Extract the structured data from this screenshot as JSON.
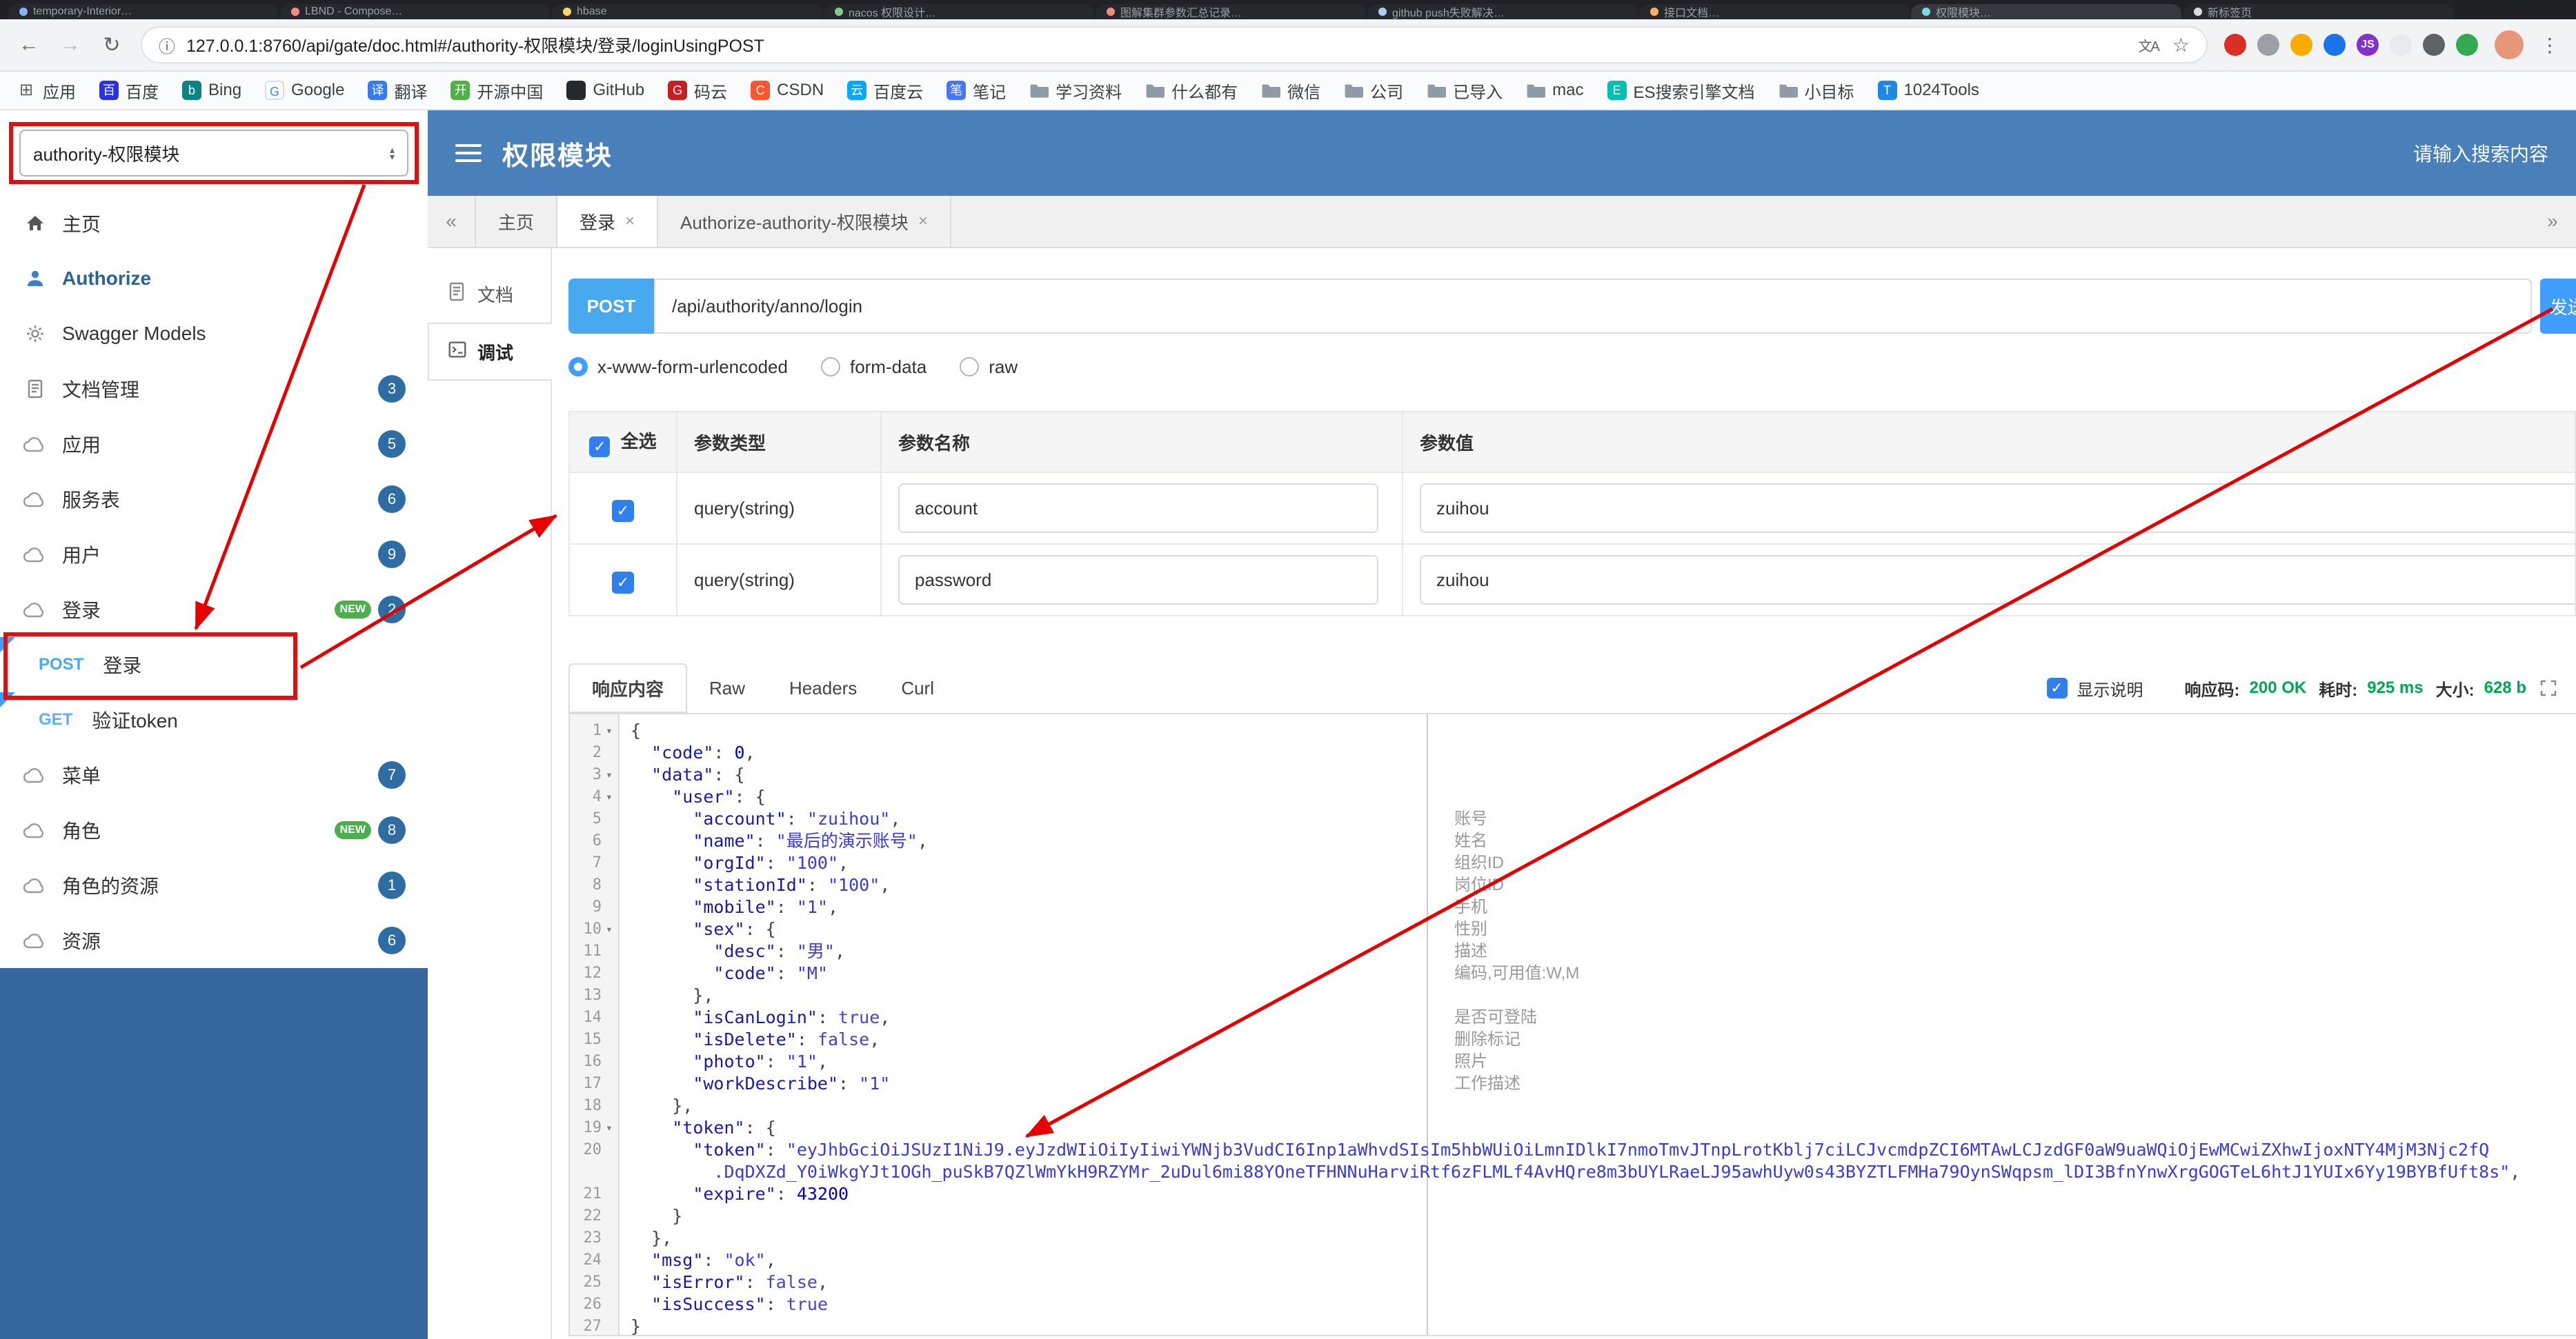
{
  "colors": {
    "header_blue": "#4a80ba",
    "sidebar_blue": "#35679e",
    "accent_blue": "#409eff",
    "method_post": "#49a9ee",
    "method_get": "#61affe",
    "badge_blue": "#2e6da4",
    "success_green": "#00a854",
    "annotation_red": "#e60000"
  },
  "browser": {
    "tabs": [
      {
        "title": "temporary-Interior…",
        "color": "#8ab4f8"
      },
      {
        "title": "LBND - Compose…",
        "color": "#f28b82"
      },
      {
        "title": "hbase",
        "color": "#fdd663"
      },
      {
        "title": "nacos 权限设计…",
        "color": "#81c995"
      },
      {
        "title": "图解集群参数汇总记录…",
        "color": "#f28b82"
      },
      {
        "title": "github push失败解决…",
        "color": "#aecbfa"
      },
      {
        "title": "接口文档…",
        "color": "#fcad70"
      },
      {
        "title": "权限模块…",
        "color": "#78d9ec",
        "active": true
      },
      {
        "title": "新标签页",
        "color": "#dadce0"
      }
    ],
    "nav": {
      "back": "←",
      "forward": "→",
      "reload": "↻"
    },
    "page_info_icon": "ⓘ",
    "url": "127.0.0.1:8760/api/gate/doc.html#/authority-权限模块/登录/loginUsingPOST",
    "translate_icon": "文A",
    "star_icon": "☆",
    "menu_icon": "⋮",
    "extensions": [
      {
        "color": "#d93025"
      },
      {
        "color": "#9aa0a6"
      },
      {
        "color": "#f9ab00"
      },
      {
        "color": "#1a73e8"
      },
      {
        "color": "#8430ce",
        "label": "JS"
      },
      {
        "color": "#e8eaed"
      },
      {
        "color": "#5f6368"
      },
      {
        "color": "#34a853"
      }
    ],
    "bookmarks": [
      {
        "name": "apps",
        "label": "应用",
        "fav": "grid"
      },
      {
        "name": "baidu",
        "label": "百度",
        "fav": "letter",
        "bg": "#2932e1",
        "ch": "百"
      },
      {
        "name": "bing",
        "label": "Bing",
        "fav": "letter",
        "bg": "#0c8484",
        "ch": "b"
      },
      {
        "name": "google",
        "label": "Google",
        "fav": "letter",
        "bg": "#ffffff",
        "ch": "G",
        "border": true
      },
      {
        "name": "translate",
        "label": "翻译",
        "fav": "letter",
        "bg": "#3479f6",
        "ch": "译"
      },
      {
        "name": "oschina",
        "label": "开源中国",
        "fav": "letter",
        "bg": "#4fb044",
        "ch": "开"
      },
      {
        "name": "github",
        "label": "GitHub",
        "fav": "letter",
        "bg": "#24292e",
        "ch": ""
      },
      {
        "name": "gitee",
        "label": "码云",
        "fav": "letter",
        "bg": "#c71d23",
        "ch": "G"
      },
      {
        "name": "csdn",
        "label": "CSDN",
        "fav": "letter",
        "bg": "#fc5531",
        "ch": "C"
      },
      {
        "name": "baiduyun",
        "label": "百度云",
        "fav": "letter",
        "bg": "#06a7ff",
        "ch": "云"
      },
      {
        "name": "note",
        "label": "笔记",
        "fav": "letter",
        "bg": "#4876f9",
        "ch": "笔"
      },
      {
        "name": "study-folder",
        "label": "学习资料",
        "fav": "folder"
      },
      {
        "name": "everything-folder",
        "label": "什么都有",
        "fav": "folder"
      },
      {
        "name": "wechat-folder",
        "label": "微信",
        "fav": "folder"
      },
      {
        "name": "company-folder",
        "label": "公司",
        "fav": "folder"
      },
      {
        "name": "imported-folder",
        "label": "已导入",
        "fav": "folder"
      },
      {
        "name": "mac-folder",
        "label": "mac",
        "fav": "folder"
      },
      {
        "name": "es-docs",
        "label": "ES搜索引擎文档",
        "fav": "letter",
        "bg": "#00bfb3",
        "ch": "E"
      },
      {
        "name": "goal-folder",
        "label": "小目标",
        "fav": "folder"
      },
      {
        "name": "tools1024",
        "label": "1024Tools",
        "fav": "letter",
        "bg": "#1e88e5",
        "ch": "T"
      }
    ]
  },
  "header": {
    "service_select": "authority-权限模块",
    "title": "权限模块",
    "search_placeholder": "请输入搜索内容"
  },
  "sidebar": {
    "items": [
      {
        "name": "home",
        "icon": "home",
        "label": "主页"
      },
      {
        "name": "authorize",
        "icon": "auth",
        "label": "Authorize",
        "bold": true,
        "color": "#2a6496"
      },
      {
        "name": "swagger-models",
        "icon": "gear",
        "label": "Swagger Models"
      },
      {
        "name": "doc-manage",
        "icon": "doc",
        "label": "文档管理",
        "badge": "3"
      },
      {
        "name": "app",
        "icon": "cloud",
        "label": "应用",
        "badge": "5"
      },
      {
        "name": "service-table",
        "icon": "cloud",
        "label": "服务表",
        "badge": "6"
      },
      {
        "name": "user",
        "icon": "cloud",
        "label": "用户",
        "badge": "9"
      },
      {
        "name": "login",
        "icon": "cloud",
        "label": "登录",
        "badge": "2",
        "isNew": true
      },
      {
        "name": "post-login",
        "sub": true,
        "method": "POST",
        "label": "登录",
        "flag": true
      },
      {
        "name": "get-verify-token",
        "sub": true,
        "method": "GET",
        "label": "验证token",
        "flag": true
      },
      {
        "name": "menu",
        "icon": "cloud",
        "label": "菜单",
        "badge": "7"
      },
      {
        "name": "role",
        "icon": "cloud",
        "label": "角色",
        "badge": "8",
        "isNew": true
      },
      {
        "name": "role-resource",
        "icon": "cloud",
        "label": "角色的资源",
        "badge": "1"
      },
      {
        "name": "resource",
        "icon": "cloud",
        "label": "资源",
        "badge": "6"
      }
    ]
  },
  "tabs": {
    "collapse_left": "«",
    "collapse_right": "»",
    "items": [
      {
        "name": "home",
        "label": "主页",
        "closable": false,
        "active": false
      },
      {
        "name": "login",
        "label": "登录",
        "closable": true,
        "active": true
      },
      {
        "name": "authorize",
        "label": "Authorize-authority-权限模块",
        "closable": true,
        "active": false
      }
    ]
  },
  "side_tabs": [
    {
      "name": "doc",
      "label": "文档",
      "icon": "doc",
      "active": false
    },
    {
      "name": "debug",
      "label": "调试",
      "icon": "debug",
      "active": true
    }
  ],
  "request": {
    "method": "POST",
    "url": "/api/authority/anno/login",
    "send_label": "发送",
    "content_types": [
      {
        "label": "x-www-form-urlencoded",
        "selected": true
      },
      {
        "label": "form-data",
        "selected": false
      },
      {
        "label": "raw",
        "selected": false
      }
    ]
  },
  "params": {
    "select_all_label": "全选",
    "headers": [
      "参数类型",
      "参数名称",
      "参数值"
    ],
    "rows": [
      {
        "checked": true,
        "type": "query(string)",
        "name_value": "account",
        "value": "zuihou"
      },
      {
        "checked": true,
        "type": "query(string)",
        "name_value": "password",
        "value": "zuihou"
      }
    ]
  },
  "response": {
    "tabs": [
      {
        "label": "响应内容",
        "active": true
      },
      {
        "label": "Raw",
        "active": false
      },
      {
        "label": "Headers",
        "active": false
      },
      {
        "label": "Curl",
        "active": false
      }
    ],
    "show_desc_checked": true,
    "show_desc_label": "显示说明",
    "meta": [
      {
        "label": "响应码:",
        "value": "200 OK"
      },
      {
        "label": "耗时:",
        "value": "925 ms"
      },
      {
        "label": "大小:",
        "value": "628 b"
      }
    ]
  },
  "code": {
    "lines": [
      {
        "n": 1,
        "fold": true,
        "tokens": [
          [
            "p",
            "{"
          ]
        ]
      },
      {
        "n": 2,
        "tokens": [
          [
            "p",
            "  "
          ],
          [
            "k",
            "\"code\""
          ],
          [
            "p",
            ": "
          ],
          [
            "n",
            "0"
          ],
          [
            "p",
            ","
          ]
        ]
      },
      {
        "n": 3,
        "fold": true,
        "tokens": [
          [
            "p",
            "  "
          ],
          [
            "k",
            "\"data\""
          ],
          [
            "p",
            ": {"
          ]
        ]
      },
      {
        "n": 4,
        "fold": true,
        "tokens": [
          [
            "p",
            "    "
          ],
          [
            "k",
            "\"user\""
          ],
          [
            "p",
            ": {"
          ]
        ]
      },
      {
        "n": 5,
        "tokens": [
          [
            "p",
            "      "
          ],
          [
            "k",
            "\"account\""
          ],
          [
            "p",
            ": "
          ],
          [
            "s",
            "\"zuihou\""
          ],
          [
            "p",
            ","
          ]
        ]
      },
      {
        "n": 6,
        "tokens": [
          [
            "p",
            "      "
          ],
          [
            "k",
            "\"name\""
          ],
          [
            "p",
            ": "
          ],
          [
            "s",
            "\"最后的演示账号\""
          ],
          [
            "p",
            ","
          ]
        ]
      },
      {
        "n": 7,
        "tokens": [
          [
            "p",
            "      "
          ],
          [
            "k",
            "\"orgId\""
          ],
          [
            "p",
            ": "
          ],
          [
            "s",
            "\"100\""
          ],
          [
            "p",
            ","
          ]
        ]
      },
      {
        "n": 8,
        "tokens": [
          [
            "p",
            "      "
          ],
          [
            "k",
            "\"stationId\""
          ],
          [
            "p",
            ": "
          ],
          [
            "s",
            "\"100\""
          ],
          [
            "p",
            ","
          ]
        ]
      },
      {
        "n": 9,
        "tokens": [
          [
            "p",
            "      "
          ],
          [
            "k",
            "\"mobile\""
          ],
          [
            "p",
            ": "
          ],
          [
            "s",
            "\"1\""
          ],
          [
            "p",
            ","
          ]
        ]
      },
      {
        "n": 10,
        "fold": true,
        "tokens": [
          [
            "p",
            "      "
          ],
          [
            "k",
            "\"sex\""
          ],
          [
            "p",
            ": {"
          ]
        ]
      },
      {
        "n": 11,
        "tokens": [
          [
            "p",
            "        "
          ],
          [
            "k",
            "\"desc\""
          ],
          [
            "p",
            ": "
          ],
          [
            "s",
            "\"男\""
          ],
          [
            "p",
            ","
          ]
        ]
      },
      {
        "n": 12,
        "tokens": [
          [
            "p",
            "        "
          ],
          [
            "k",
            "\"code\""
          ],
          [
            "p",
            ": "
          ],
          [
            "s",
            "\"M\""
          ]
        ]
      },
      {
        "n": 13,
        "tokens": [
          [
            "p",
            "      },"
          ]
        ]
      },
      {
        "n": 14,
        "tokens": [
          [
            "p",
            "      "
          ],
          [
            "k",
            "\"isCanLogin\""
          ],
          [
            "p",
            ": "
          ],
          [
            "b",
            "true"
          ],
          [
            "p",
            ","
          ]
        ]
      },
      {
        "n": 15,
        "tokens": [
          [
            "p",
            "      "
          ],
          [
            "k",
            "\"isDelete\""
          ],
          [
            "p",
            ": "
          ],
          [
            "b",
            "false"
          ],
          [
            "p",
            ","
          ]
        ]
      },
      {
        "n": 16,
        "tokens": [
          [
            "p",
            "      "
          ],
          [
            "k",
            "\"photo\""
          ],
          [
            "p",
            ": "
          ],
          [
            "s",
            "\"1\""
          ],
          [
            "p",
            ","
          ]
        ]
      },
      {
        "n": 17,
        "tokens": [
          [
            "p",
            "      "
          ],
          [
            "k",
            "\"workDescribe\""
          ],
          [
            "p",
            ": "
          ],
          [
            "s",
            "\"1\""
          ]
        ]
      },
      {
        "n": 18,
        "tokens": [
          [
            "p",
            "    },"
          ]
        ]
      },
      {
        "n": 19,
        "fold": true,
        "tokens": [
          [
            "p",
            "    "
          ],
          [
            "k",
            "\"token\""
          ],
          [
            "p",
            ": {"
          ]
        ]
      },
      {
        "n": 20,
        "tokens": [
          [
            "p",
            "      "
          ],
          [
            "k",
            "\"token\""
          ],
          [
            "p",
            ": "
          ],
          [
            "s",
            "\"eyJhbGciOiJSUzI1NiJ9.eyJzdWIiOiIyIiwiYWNjb3VudCI6Inp1aWhvdSIsIm5hbWUiOiLmnIDlkI7nmoTmvJTnpLrotKblj7ciLCJvcmdpZCI6MTAwLCJzdGF0aW9uaWQiOjEwMCwiZXhwIjoxNTY4MjM3Njc2fQ"
          ]
        ]
      },
      {
        "n": null,
        "tokens": [
          [
            "p",
            "        "
          ],
          [
            "s",
            ".DqDXZd_Y0iWkgYJt1OGh_puSkB7QZlWmYkH9RZYMr_2uDul6mi88YOneTFHNNuHarviRtf6zFLMLf4AvHQre8m3bUYLRaeLJ95awhUyw0s43BYZTLFMHa79OynSWqpsm_lDI3BfnYnwXrgGOGTeL6htJ1YUIx6Yy19BYBfUft8s\""
          ],
          [
            "p",
            ","
          ]
        ]
      },
      {
        "n": 21,
        "tokens": [
          [
            "p",
            "      "
          ],
          [
            "k",
            "\"expire\""
          ],
          [
            "p",
            ": "
          ],
          [
            "n",
            "43200"
          ]
        ]
      },
      {
        "n": 22,
        "tokens": [
          [
            "p",
            "    }"
          ]
        ]
      },
      {
        "n": 23,
        "tokens": [
          [
            "p",
            "  },"
          ]
        ]
      },
      {
        "n": 24,
        "tokens": [
          [
            "p",
            "  "
          ],
          [
            "k",
            "\"msg\""
          ],
          [
            "p",
            ": "
          ],
          [
            "s",
            "\"ok\""
          ],
          [
            "p",
            ","
          ]
        ]
      },
      {
        "n": 25,
        "tokens": [
          [
            "p",
            "  "
          ],
          [
            "k",
            "\"isError\""
          ],
          [
            "p",
            ": "
          ],
          [
            "b",
            "false"
          ],
          [
            "p",
            ","
          ]
        ]
      },
      {
        "n": 26,
        "tokens": [
          [
            "p",
            "  "
          ],
          [
            "k",
            "\"isSuccess\""
          ],
          [
            "p",
            ": "
          ],
          [
            "b",
            "true"
          ]
        ]
      },
      {
        "n": 27,
        "tokens": [
          [
            "p",
            "}"
          ]
        ]
      }
    ]
  },
  "annotations": {
    "items": [
      {
        "row": 5,
        "text": "账号"
      },
      {
        "row": 6,
        "text": "姓名"
      },
      {
        "row": 7,
        "text": "组织ID"
      },
      {
        "row": 8,
        "text": "岗位ID"
      },
      {
        "row": 9,
        "text": "手机"
      },
      {
        "row": 10,
        "text": "性别"
      },
      {
        "row": 11,
        "text": "描述"
      },
      {
        "row": 12,
        "text": "编码,可用值:W,M"
      },
      {
        "row": 14,
        "text": "是否可登陆"
      },
      {
        "row": 15,
        "text": "删除标记"
      },
      {
        "row": 16,
        "text": "照片"
      },
      {
        "row": 17,
        "text": "工作描述"
      }
    ]
  }
}
